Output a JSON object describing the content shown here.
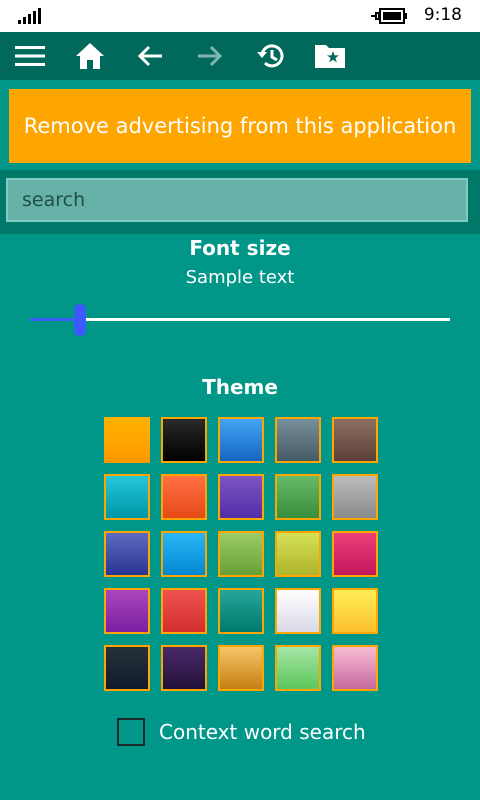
{
  "status_bar": {
    "time": "9:18",
    "icons": [
      "signal-icon",
      "battery-charging-icon"
    ]
  },
  "toolbar": {
    "icons": [
      "menu-icon",
      "home-icon",
      "back-arrow-icon",
      "forward-arrow-icon",
      "history-icon",
      "favorites-folder-icon"
    ],
    "forward_enabled": false
  },
  "ad_banner": {
    "text": "Remove advertising from this application",
    "color": "#ffa500"
  },
  "search": {
    "placeholder": "search",
    "value": ""
  },
  "font_size": {
    "title": "Font size",
    "sample": "Sample text",
    "slider_fraction": 0.12
  },
  "theme": {
    "title": "Theme",
    "selected_index": 0,
    "swatches": [
      {
        "from": "#ffb300",
        "to": "#ff9800"
      },
      {
        "from": "#2a2a2a",
        "to": "#000000"
      },
      {
        "from": "#42a5f5",
        "to": "#1565c0"
      },
      {
        "from": "#78909c",
        "to": "#455a64"
      },
      {
        "from": "#8d6e63",
        "to": "#5d4037"
      },
      {
        "from": "#26c6da",
        "to": "#0097a7"
      },
      {
        "from": "#ff7043",
        "to": "#e64a19"
      },
      {
        "from": "#7e57c2",
        "to": "#512da8"
      },
      {
        "from": "#66bb6a",
        "to": "#388e3c"
      },
      {
        "from": "#bdbdbd",
        "to": "#8a8a8a"
      },
      {
        "from": "#5c6bc0",
        "to": "#283593"
      },
      {
        "from": "#29b6f6",
        "to": "#0288d1"
      },
      {
        "from": "#9ccc65",
        "to": "#689f38"
      },
      {
        "from": "#d4e157",
        "to": "#afb42b"
      },
      {
        "from": "#ec407a",
        "to": "#c2185b"
      },
      {
        "from": "#ab47bc",
        "to": "#7b1fa2"
      },
      {
        "from": "#ef5350",
        "to": "#d32f2f"
      },
      {
        "from": "#26a69a",
        "to": "#00796b"
      },
      {
        "from": "#ffffff",
        "to": "#d8d8e6"
      },
      {
        "from": "#ffee58",
        "to": "#fbc02d"
      },
      {
        "from": "#263238",
        "to": "#0f1a2e"
      },
      {
        "from": "#4a2a6a",
        "to": "#22103a"
      },
      {
        "from": "#f5c56a",
        "to": "#c77f10"
      },
      {
        "from": "#a5e6a5",
        "to": "#5cc65c"
      },
      {
        "from": "#f8bbd0",
        "to": "#c66aa0"
      }
    ]
  },
  "context_search": {
    "label": "Context word search",
    "checked": false
  }
}
